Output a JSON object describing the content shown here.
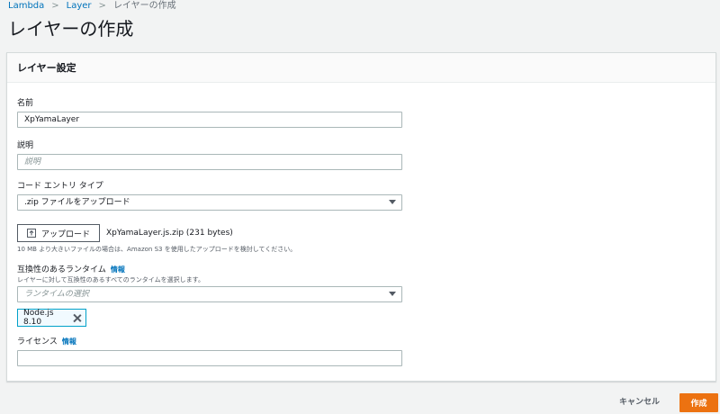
{
  "breadcrumb": {
    "items": [
      "Lambda",
      "Layer"
    ],
    "current": "レイヤーの作成"
  },
  "page": {
    "title": "レイヤーの作成"
  },
  "card": {
    "title": "レイヤー設定"
  },
  "form": {
    "name": {
      "label": "名前",
      "value": "XpYamaLayer"
    },
    "description": {
      "label": "説明",
      "placeholder": "説明"
    },
    "code_entry": {
      "label": "コード エントリ タイプ",
      "value": ".zip ファイルをアップロード"
    },
    "upload": {
      "button_label": "アップロード",
      "file_name": "XpYamaLayer.js.zip (231 bytes)",
      "hint": "10 MB より大きいファイルの場合は、Amazon S3 を使用したアップロードを検討してください。"
    },
    "runtime": {
      "label": "互換性のあるランタイム",
      "info": "情報",
      "hint": "レイヤーに対して互換性のあるすべてのランタイムを選択します。",
      "placeholder": "ランタイムの選択",
      "selected_token": "Node.js 8.10"
    },
    "license": {
      "label": "ライセンス",
      "info": "情報",
      "value": ""
    }
  },
  "footer": {
    "cancel_label": "キャンセル",
    "create_label": "作成"
  },
  "colors": {
    "accent": "#ec7211",
    "link": "#0073bb"
  },
  "icons": {
    "upload": "upload-icon",
    "remove": "close-icon",
    "select": "caret-down-icon",
    "separator": "chevron-right-icon"
  }
}
